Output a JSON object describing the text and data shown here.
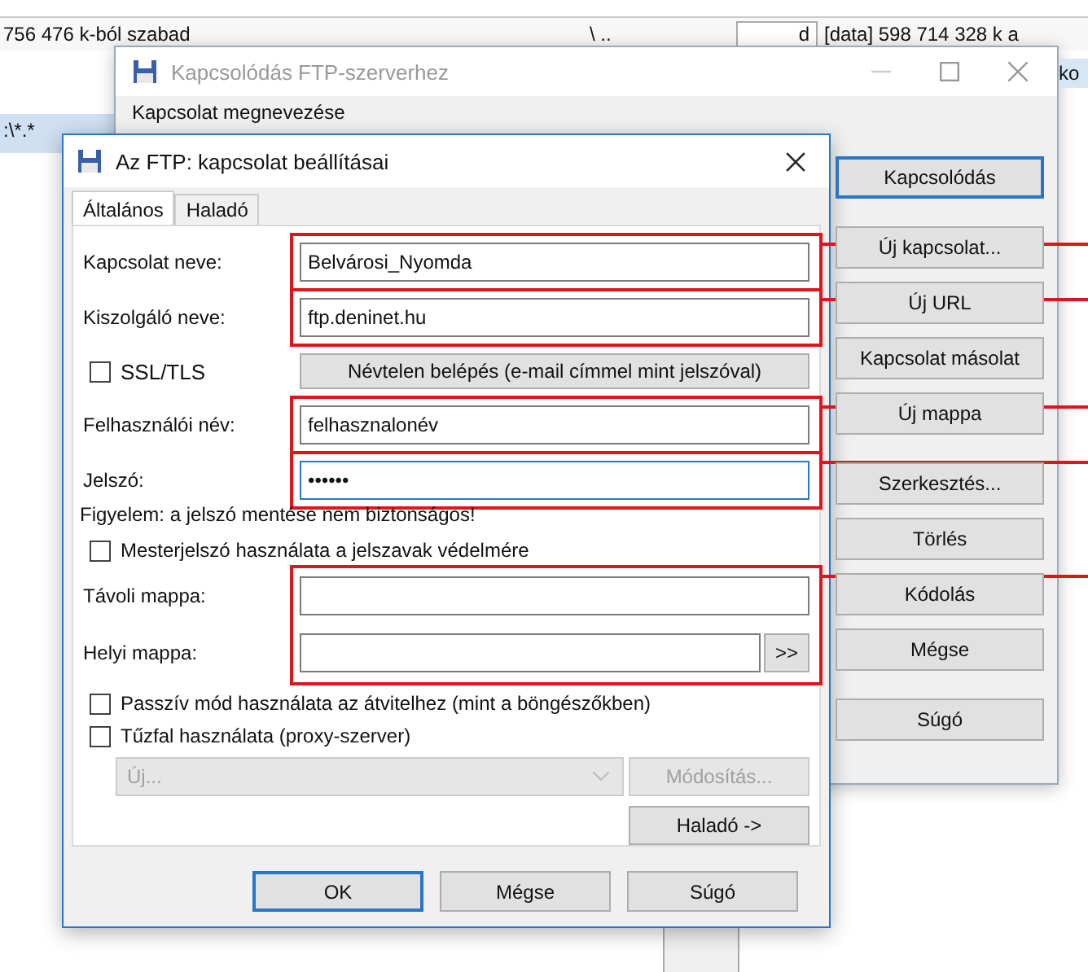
{
  "background": {
    "free_space": "756 476 k-ból szabad",
    "path": "\\ ..",
    "drive": "d",
    "drive_info": "[data]  598 714 328 k a",
    "right_fragment": "ko",
    "left_path": ":\\*.*"
  },
  "outer_window": {
    "title": "Kapcsolódás FTP-szerverhez",
    "field_label": "Kapcsolat megnevezése",
    "button_groups": [
      [
        {
          "label": "Kapcsolódás",
          "default": true
        }
      ],
      [
        {
          "label": "Új kapcsolat...",
          "default": false
        },
        {
          "label": "Új URL",
          "default": false
        },
        {
          "label": "Kapcsolat másolat",
          "default": false
        },
        {
          "label": "Új mappa",
          "default": false
        }
      ],
      [
        {
          "label": "Szerkesztés...",
          "default": false
        },
        {
          "label": "Törlés",
          "default": false
        },
        {
          "label": "Kódolás",
          "default": false
        },
        {
          "label": "Mégse",
          "default": false
        }
      ],
      [
        {
          "label": "Súgó",
          "default": false
        }
      ]
    ]
  },
  "dialog": {
    "title": "Az FTP: kapcsolat beállításai",
    "tabs": [
      {
        "label": "Általános",
        "selected": true
      },
      {
        "label": "Haladó",
        "selected": false
      }
    ],
    "rows": [
      {
        "kind": "text",
        "label": "Kapcsolat neve:",
        "value": "Belvárosi_Nyomda",
        "focused": false,
        "highlighted": true
      },
      {
        "kind": "text",
        "label": "Kiszolgáló neve:",
        "value": "ftp.deninet.hu",
        "focused": false,
        "highlighted": true
      },
      {
        "kind": "checkbox_button",
        "label": "SSL/TLS",
        "checked": false,
        "button": "Névtelen belépés (e-mail címmel mint jelszóval)"
      },
      {
        "kind": "text",
        "label": "Felhasználói név:",
        "value": "felhasznalonév",
        "focused": false,
        "highlighted": true
      },
      {
        "kind": "text",
        "label": "Jelszó:",
        "value": "••••••",
        "focused": true,
        "highlighted": true
      },
      {
        "kind": "note",
        "text": "Figyelem: a jelszó mentése nem biztonságos!"
      },
      {
        "kind": "checkbox",
        "label": "Mesterjelszó használata a jelszavak védelmére",
        "checked": false
      },
      {
        "kind": "group",
        "highlighted": true,
        "children": [
          {
            "kind": "text",
            "label": "Távoli mappa:"
          },
          {
            "kind": "browse",
            "label": "Helyi mappa:",
            "button": ">>"
          }
        ]
      },
      {
        "kind": "checkbox",
        "label": "Passzív mód használata az átvitelhez (mint a böngészőkben)",
        "checked": false
      },
      {
        "kind": "checkbox",
        "label": "Tűzfal használata (proxy-szerver)",
        "checked": false
      },
      {
        "kind": "proxy",
        "value": "Új...",
        "button": "Módosítás...",
        "disabled": true
      },
      {
        "kind": "button",
        "label": "Haladó ->"
      }
    ],
    "buttons": [
      {
        "label": "OK",
        "default": true
      },
      {
        "label": "Mégse",
        "default": false
      },
      {
        "label": "Súgó",
        "default": false
      }
    ]
  }
}
